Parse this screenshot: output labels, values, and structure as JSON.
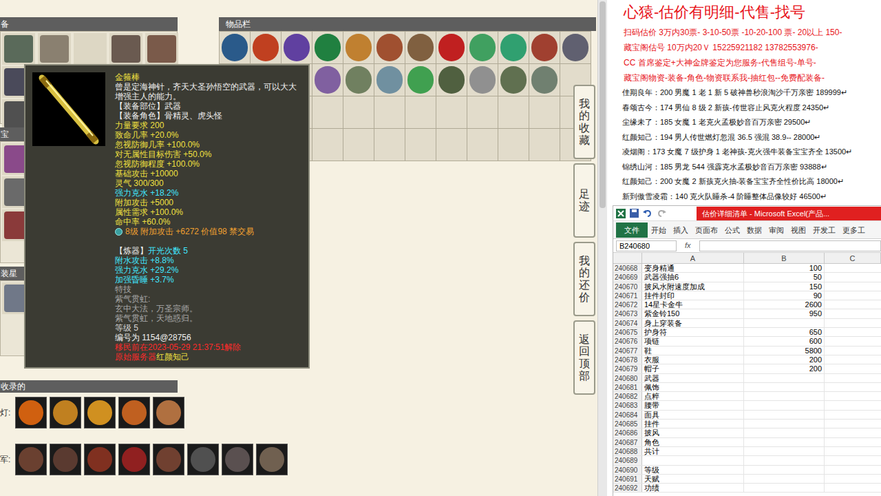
{
  "game": {
    "equip_panel": {
      "title": "备",
      "slots": [
        {
          "filled": true,
          "color": "#5a6a5a"
        },
        {
          "filled": true,
          "color": "#8a8070"
        },
        {
          "filled": false
        },
        {
          "filled": true,
          "color": "#6a5a50"
        },
        {
          "filled": true,
          "color": "#7a5a4a"
        },
        {
          "filled": true,
          "color": "#4a4a5a"
        },
        {
          "filled": false
        },
        {
          "filled": false
        },
        {
          "filled": false
        },
        {
          "filled": false
        },
        {
          "filled": true,
          "color": "#505050"
        },
        {
          "filled": false
        },
        {
          "filled": false
        },
        {
          "filled": false
        },
        {
          "filled": false
        }
      ]
    },
    "treasure_panel": {
      "title": "宝",
      "slots": [
        {
          "filled": true,
          "color": "#8a4a8a"
        },
        {
          "filled": false
        },
        {
          "filled": false
        },
        {
          "filled": false
        },
        {
          "filled": false
        },
        {
          "filled": true,
          "color": "#6a6a6a"
        },
        {
          "filled": false
        },
        {
          "filled": false
        },
        {
          "filled": false
        },
        {
          "filled": false
        },
        {
          "filled": true,
          "color": "#8a3a3a"
        },
        {
          "filled": false
        },
        {
          "filled": false
        },
        {
          "filled": false
        },
        {
          "filled": false
        }
      ]
    },
    "star_panel": {
      "title": "装星",
      "slots": [
        {
          "filled": true,
          "color": "#707888"
        },
        {
          "filled": false
        },
        {
          "filled": false
        },
        {
          "filled": false
        },
        {
          "filled": false
        }
      ]
    },
    "items_panel": {
      "title": "物品栏",
      "slots": [
        {
          "filled": true,
          "color": "#2a5a8a"
        },
        {
          "filled": true,
          "color": "#c04020"
        },
        {
          "filled": true,
          "color": "#6040a0"
        },
        {
          "filled": true,
          "color": "#208040"
        },
        {
          "filled": true,
          "color": "#c08030"
        },
        {
          "filled": true,
          "color": "#a05030"
        },
        {
          "filled": true,
          "color": "#806040"
        },
        {
          "filled": true,
          "color": "#c02020"
        },
        {
          "filled": true,
          "color": "#40a060"
        },
        {
          "filled": true,
          "color": "#30a070"
        },
        {
          "filled": true,
          "color": "#a04030"
        },
        {
          "filled": true,
          "color": "#606070"
        },
        {
          "filled": true,
          "color": "#5070a0"
        },
        {
          "filled": true,
          "color": "#404040"
        },
        {
          "filled": true,
          "color": "#3060d0"
        },
        {
          "filled": true,
          "color": "#8060a0"
        },
        {
          "filled": true,
          "color": "#708060"
        },
        {
          "filled": true,
          "color": "#7090a0"
        },
        {
          "filled": true,
          "color": "#40a050"
        },
        {
          "filled": true,
          "color": "#506040"
        },
        {
          "filled": true,
          "color": "#909090"
        },
        {
          "filled": true,
          "color": "#607050"
        },
        {
          "filled": true,
          "color": "#708070"
        },
        {
          "filled": false
        },
        {
          "filled": false
        },
        {
          "filled": false
        },
        {
          "filled": false
        },
        {
          "filled": false
        },
        {
          "filled": false
        },
        {
          "filled": false
        },
        {
          "filled": false
        },
        {
          "filled": false
        },
        {
          "filled": false
        },
        {
          "filled": false
        },
        {
          "filled": false
        },
        {
          "filled": false
        },
        {
          "filled": false
        },
        {
          "filled": false
        },
        {
          "filled": false
        },
        {
          "filled": false
        },
        {
          "filled": false
        },
        {
          "filled": false
        },
        {
          "filled": false
        },
        {
          "filled": false
        },
        {
          "filled": false
        },
        {
          "filled": false
        },
        {
          "filled": false
        },
        {
          "filled": false
        }
      ]
    },
    "tooltip": {
      "lines": [
        {
          "kind": "text",
          "segments": [
            {
              "text": "金箍棒",
              "color": "#f0e040"
            }
          ]
        },
        {
          "kind": "text",
          "segments": [
            {
              "text": "曾是定海神针，齐天大圣孙悟空的武器，可以大大增强主人的能力。",
              "color": "#f0f0f0"
            }
          ]
        },
        {
          "kind": "text",
          "segments": [
            {
              "text": "【装备部位】武器",
              "color": "#f0f0f0"
            }
          ]
        },
        {
          "kind": "text",
          "segments": [
            {
              "text": "【装备角色】骨精灵、虎头怪",
              "color": "#f0f0f0"
            }
          ]
        },
        {
          "kind": "text",
          "segments": [
            {
              "text": "力量要求 200",
              "color": "#f0e040"
            }
          ]
        },
        {
          "kind": "text",
          "segments": [
            {
              "text": "致命几率 +20.0%",
              "color": "#f0e040"
            }
          ]
        },
        {
          "kind": "text",
          "segments": [
            {
              "text": "忽视防御几率 +100.0%",
              "color": "#f0e040"
            }
          ]
        },
        {
          "kind": "text",
          "segments": [
            {
              "text": "对无属性目标伤害 +50.0%",
              "color": "#f0e040"
            }
          ]
        },
        {
          "kind": "text",
          "segments": [
            {
              "text": "忽视防御程度 +100.0%",
              "color": "#f0e040"
            }
          ]
        },
        {
          "kind": "text",
          "segments": [
            {
              "text": "基础攻击 +10000",
              "color": "#f0e040"
            }
          ]
        },
        {
          "kind": "text",
          "segments": [
            {
              "text": "灵气 300/300",
              "color": "#f0e040"
            }
          ]
        },
        {
          "kind": "text",
          "segments": [
            {
              "text": "强力克水 +18.2%",
              "color": "#40e8ff"
            }
          ]
        },
        {
          "kind": "text",
          "segments": [
            {
              "text": "附加攻击 +5000",
              "color": "#f0e040"
            }
          ]
        },
        {
          "kind": "text",
          "segments": [
            {
              "text": "属性需求 +100.0%",
              "color": "#f0e040"
            }
          ]
        },
        {
          "kind": "text",
          "segments": [
            {
              "text": "命中率 +60.0%",
              "color": "#f0e040"
            }
          ]
        },
        {
          "kind": "gem",
          "segments": [
            {
              "text": "8级 附加攻击 +6272 价值98 禁交易",
              "color": "#f0a030"
            }
          ]
        },
        {
          "kind": "blank",
          "segments": []
        },
        {
          "kind": "text",
          "segments": [
            {
              "text": "【炼器】",
              "color": "#f0f0f0"
            },
            {
              "text": "开光次数 5",
              "color": "#40e8ff"
            }
          ]
        },
        {
          "kind": "text",
          "segments": [
            {
              "text": "附水攻击 +8.8%",
              "color": "#40e8ff"
            }
          ]
        },
        {
          "kind": "text",
          "segments": [
            {
              "text": "强力克水 +29.2%",
              "color": "#40e8ff"
            }
          ]
        },
        {
          "kind": "text",
          "segments": [
            {
              "text": "加强昏睡 +3.7%",
              "color": "#40e8ff"
            }
          ]
        },
        {
          "kind": "text",
          "segments": [
            {
              "text": "特技",
              "color": "#a8a8a8"
            }
          ]
        },
        {
          "kind": "text",
          "segments": [
            {
              "text": "紫气贯虹:",
              "color": "#a8a8a8"
            }
          ]
        },
        {
          "kind": "text",
          "segments": [
            {
              "text": "玄中大法，万圣宗师。",
              "color": "#a8a8a8"
            }
          ]
        },
        {
          "kind": "text",
          "segments": [
            {
              "text": "紫气贯虹，天地惑归。",
              "color": "#a8a8a8"
            }
          ]
        },
        {
          "kind": "text",
          "segments": [
            {
              "text": "等级 5",
              "color": "#d8d8d8"
            }
          ]
        },
        {
          "kind": "text",
          "segments": [
            {
              "text": "编号为 1154@28756",
              "color": "#f0f0f0"
            }
          ]
        },
        {
          "kind": "text",
          "segments": [
            {
              "text": "移民前在2023-05-29 21:37:51解除",
              "color": "#ff2a2a"
            }
          ]
        },
        {
          "kind": "text",
          "segments": [
            {
              "text": "原始服务器 ",
              "color": "#ff2a2a"
            },
            {
              "text": "红颜知己",
              "color": "#f0e040"
            }
          ]
        }
      ]
    },
    "side_tabs": [
      "我的收藏",
      "足迹",
      "我的还价",
      "返回顶部"
    ],
    "record_label": "收录的",
    "lamp": {
      "label": "灯:",
      "icons": [
        "#d06010",
        "#c08020",
        "#d09020",
        "#c06020",
        "#b07040"
      ]
    },
    "army": {
      "label": "军:",
      "icons": [
        "#6a4030",
        "#5a3a30",
        "#803020",
        "#902020",
        "#704030",
        "#505050",
        "#5a5050",
        "#706050"
      ]
    }
  },
  "ad": {
    "title": "心猿-估价有明细-代售-找号",
    "promo_lines": [
      "扫码估价 3万内30票- 3-10-50票 -10-20-100 票- 20以上 150-",
      "藏宝阁估号 10万内20Ｖ 15225921182   13782553976-",
      "CC 首席鉴定+大神金牌鉴定为您服务-代售组号-单号-",
      "藏宝阁物资-装备-角色-物资联系我-抽红包--免费配装备-"
    ],
    "listings": [
      "佳期良年：200 男魔 1 老 1 新 5 破神兽秒浪淘沙千万亲密 189999↵",
      "春颂古今：174 男仙 8 级 2 新孩-传世容止风克火程度 24350↵",
      "尘缘未了：185 女魔 1 老克火孟极妙音百万亲密 29500↵",
      "红颜知己：194 男人传世燃灯忽混 36.5 强混 38.9-- 28000↵",
      "凌烟阁：173 女魔 7 级护身 1 老神孩-克火强牛装备宝宝齐全 13500↵",
      "锦绣山河：185 男龙 544 强霹克水孟极妙音百万亲密 93888↵",
      "红颜知己：200 女魔 2 新孩克火抽-装备宝宝齐全性价比高 18000↵",
      "新到傲雪凌霜：140 克火队睡杀-4 阶睡整体品像较好 46500↵"
    ]
  },
  "excel": {
    "title": "估价详细清单 - Microsoft Excel(产品...",
    "tabs": [
      {
        "label": "文件",
        "kind": "file"
      },
      {
        "label": "开始",
        "kind": "tab"
      },
      {
        "label": "插入",
        "kind": "tab"
      },
      {
        "label": "页面布",
        "kind": "tab"
      },
      {
        "label": "公式",
        "kind": "tab"
      },
      {
        "label": "数据",
        "kind": "tab"
      },
      {
        "label": "审阅",
        "kind": "tab"
      },
      {
        "label": "视图",
        "kind": "tab"
      },
      {
        "label": "开发工",
        "kind": "tab"
      },
      {
        "label": "更多工",
        "kind": "tab"
      }
    ],
    "name_box": "B240680",
    "fx": "fx",
    "columns": [
      "A",
      "B",
      "C"
    ],
    "rows": [
      {
        "num": "240668",
        "a": "变身精通",
        "b": "100"
      },
      {
        "num": "240669",
        "a": "武器强抽6",
        "b": "50"
      },
      {
        "num": "240670",
        "a": "披风水附速度加成",
        "b": "150"
      },
      {
        "num": "240671",
        "a": "挂件封印",
        "b": "90"
      },
      {
        "num": "240672",
        "a": "14星卡金牛",
        "b": "2600"
      },
      {
        "num": "240673",
        "a": "紫金铃150",
        "b": "950"
      },
      {
        "num": "240674",
        "a": "身上穿装备",
        "b": ""
      },
      {
        "num": "240675",
        "a": "护身符",
        "b": "650"
      },
      {
        "num": "240676",
        "a": "项链",
        "b": "600"
      },
      {
        "num": "240677",
        "a": "鞋",
        "b": "5800"
      },
      {
        "num": "240678",
        "a": "衣服",
        "b": "200"
      },
      {
        "num": "240679",
        "a": "帽子",
        "b": "200"
      },
      {
        "num": "240680",
        "a": "武器",
        "b": ""
      },
      {
        "num": "240681",
        "a": "佩饰",
        "b": ""
      },
      {
        "num": "240682",
        "a": "点粹",
        "b": ""
      },
      {
        "num": "240683",
        "a": "腰带",
        "b": ""
      },
      {
        "num": "240684",
        "a": "面具",
        "b": ""
      },
      {
        "num": "240685",
        "a": "挂件",
        "b": ""
      },
      {
        "num": "240686",
        "a": "披风",
        "b": ""
      },
      {
        "num": "240687",
        "a": "角色",
        "b": ""
      },
      {
        "num": "240688",
        "a": "共计",
        "b": ""
      },
      {
        "num": "240689",
        "a": "",
        "b": ""
      },
      {
        "num": "240690",
        "a": "等级",
        "b": ""
      },
      {
        "num": "240691",
        "a": "天赋",
        "b": ""
      },
      {
        "num": "240692",
        "a": "功绩",
        "b": ""
      }
    ]
  }
}
